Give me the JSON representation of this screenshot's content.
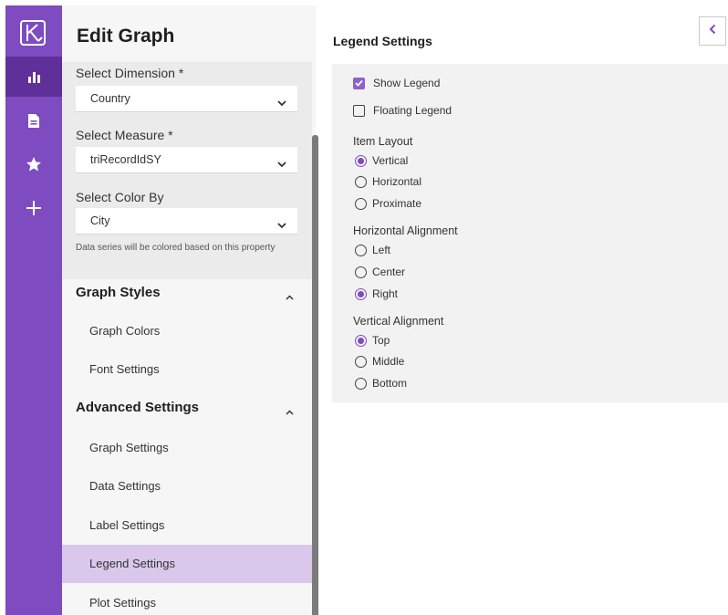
{
  "panel": {
    "title": "Edit Graph",
    "form": {
      "dimension_label": "Select Dimension *",
      "dimension_value": "Country",
      "measure_label": "Select Measure *",
      "measure_value": "triRecordIdSY",
      "color_label": "Select Color By",
      "color_value": "City",
      "color_hint": "Data series will be colored based on this property"
    },
    "sections": {
      "graph_styles": {
        "title": "Graph Styles",
        "items": [
          "Graph Colors",
          "Font Settings"
        ]
      },
      "advanced_settings": {
        "title": "Advanced Settings",
        "items": [
          "Graph Settings",
          "Data Settings",
          "Label Settings",
          "Legend Settings",
          "Plot Settings"
        ],
        "active_index": 3
      }
    }
  },
  "legend": {
    "title": "Legend Settings",
    "show_legend": {
      "label": "Show Legend",
      "checked": true
    },
    "floating_legend": {
      "label": "Floating Legend",
      "checked": false
    },
    "item_layout": {
      "label": "Item Layout",
      "options": [
        "Vertical",
        "Horizontal",
        "Proximate"
      ],
      "selected": "Vertical"
    },
    "horizontal_alignment": {
      "label": "Horizontal Alignment",
      "options": [
        "Left",
        "Center",
        "Right"
      ],
      "selected": "Right"
    },
    "vertical_alignment": {
      "label": "Vertical Alignment",
      "options": [
        "Top",
        "Middle",
        "Bottom"
      ],
      "selected": "Top"
    }
  },
  "rail": {
    "icons": [
      "logo-icon",
      "bar-chart-icon",
      "document-icon",
      "star-icon",
      "plus-icon"
    ],
    "active": "bar-chart-icon"
  },
  "colors": {
    "rail": "#7e4cc0",
    "rail_active": "#5f2f9a",
    "active_item": "#d9c8ec",
    "accent": "#8f5fd0"
  }
}
